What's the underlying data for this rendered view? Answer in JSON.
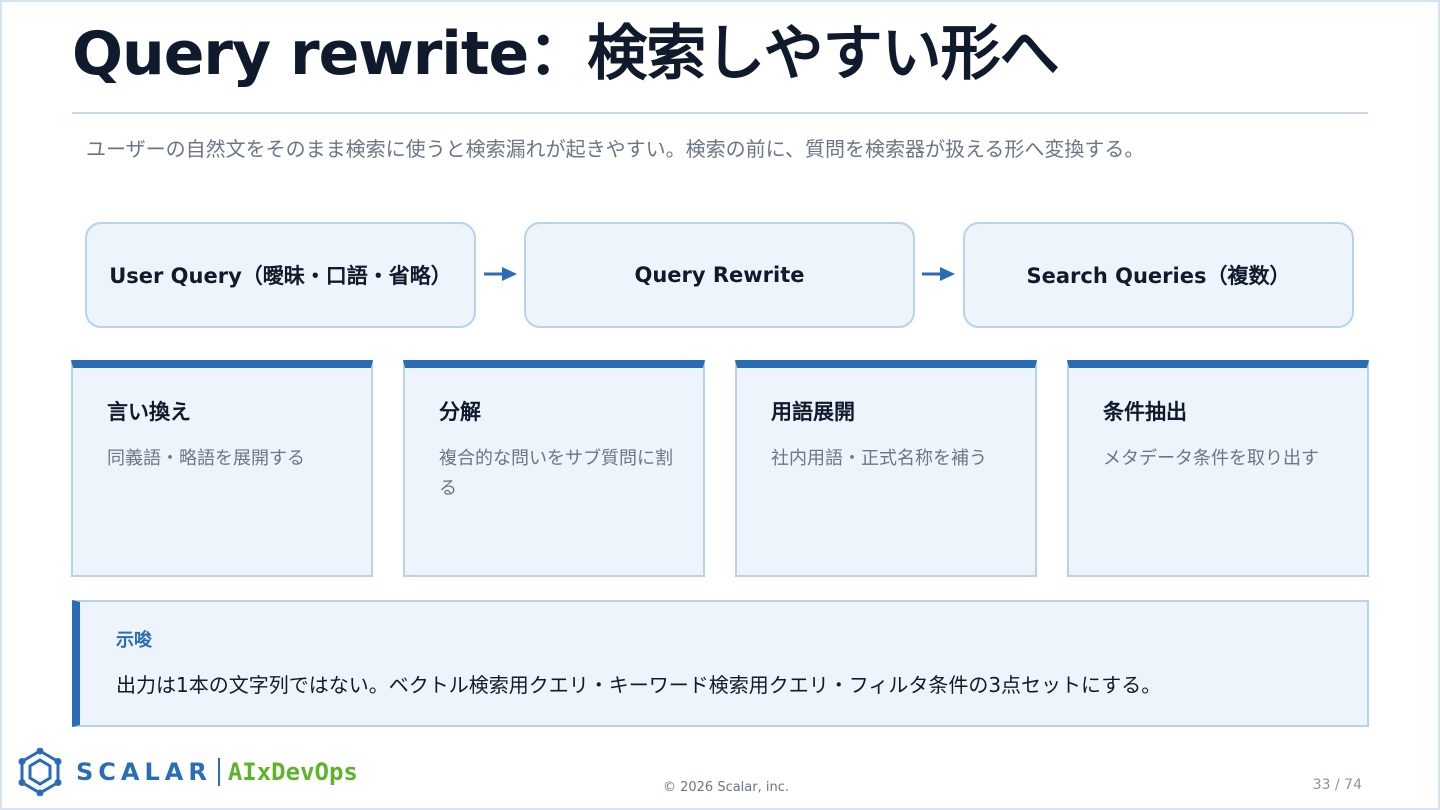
{
  "slide": {
    "title": "Query rewrite：検索しやすい形へ",
    "subtitle": "ユーザーの自然文をそのまま検索に使うと検索漏れが起きやすい。検索の前に、質問を検索器が扱える形へ変換する。"
  },
  "flow": [
    {
      "label": "User Query（曖昧・口語・省略）"
    },
    {
      "label": "Query Rewrite"
    },
    {
      "label": "Search Queries（複数）"
    }
  ],
  "cards": [
    {
      "title": "言い換え",
      "desc": "同義語・略語を展開する"
    },
    {
      "title": "分解",
      "desc": "複合的な問いをサブ質問に割る"
    },
    {
      "title": "用語展開",
      "desc": "社内用語・正式名称を補う"
    },
    {
      "title": "条件抽出",
      "desc": "メタデータ条件を取り出す"
    }
  ],
  "note": {
    "label": "示唆",
    "text": "出力は1本の文字列ではない。ベクトル検索用クエリ・キーワード検索用クエリ・フィルタ条件の3点セットにする。"
  },
  "footer": {
    "brand": "SCALAR",
    "sub_brand": "AIxDevOps",
    "copyright": "© 2026 Scalar, inc.",
    "page": "33 / 74"
  },
  "colors": {
    "accent": "#2a6db5",
    "box_bg": "#eef4fb",
    "box_border": "#b8d2ec",
    "logo_green": "#5fb32a",
    "text_dark": "#0f1b2d",
    "text_muted": "#6b7686"
  },
  "icons": {
    "flow_arrow": "arrow-right-icon",
    "logo": "scalar-logo-icon"
  }
}
